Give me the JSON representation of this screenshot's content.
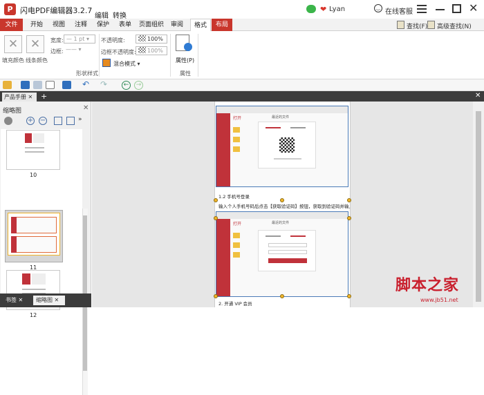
{
  "app": {
    "title": "闪电PDF编辑器3.2.7",
    "menu_edit": "编辑",
    "menu_convert": "转换",
    "user": "Lyan",
    "support": "在线客服"
  },
  "tabs": [
    "文件",
    "开始",
    "视图",
    "注释",
    "保护",
    "表单",
    "页面组织",
    "审阅",
    "格式",
    "布局"
  ],
  "search": {
    "find": "查找(F)",
    "advanced": "高级查找(N)"
  },
  "ribbon": {
    "fill_color": "填充颜色",
    "line_color": "线条颜色",
    "width_label": "宽度:",
    "width_value": "1 pt",
    "border_label": "边框:",
    "opacity_label": "不透明度:",
    "opacity_value": "100%",
    "border_opacity_label": "边框不透明度:",
    "border_opacity_value": "100%",
    "blend_mode": "混合模式",
    "group_shape": "形状样式",
    "properties": "属性(P)",
    "group_props": "属性"
  },
  "document_tab": "产品手册",
  "left_panel": {
    "title": "缩略图",
    "pages": [
      "10",
      "11",
      "12"
    ],
    "bottom_tabs": [
      "书签",
      "缩略图"
    ]
  },
  "page": {
    "line1": "1.2 手机号登录",
    "line2": "输入个人手机号码后点击【获取验证码】按钮，获取到验证码并输入即可登录。",
    "line3": "2. 开通 VIP 会员",
    "shot_title": "打开",
    "shot_recent": "最近的文件"
  },
  "watermark": {
    "text": "脚本之家",
    "url": "www.jb51.net"
  },
  "colors": {
    "brand": "#c9362c",
    "selection": "#4a7ab7",
    "handle": "#f0b52b"
  }
}
